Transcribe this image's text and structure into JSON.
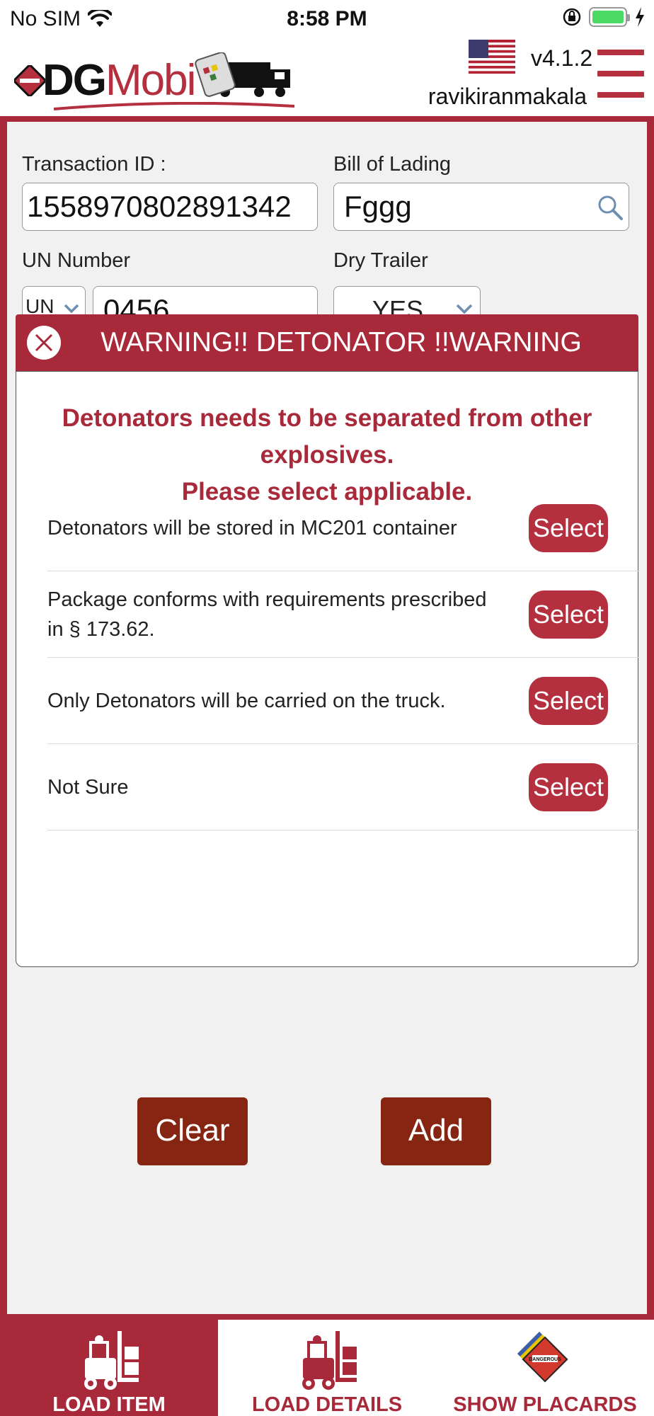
{
  "status_bar": {
    "carrier": "No SIM",
    "time": "8:58 PM"
  },
  "header": {
    "logo_dg": "DG",
    "logo_mobi": "Mobi",
    "version": "v4.1.2",
    "username": "ravikiranmakala"
  },
  "form": {
    "transaction_label": "Transaction ID :",
    "transaction_value": "1558970802891342",
    "bol_label": "Bill of Lading",
    "bol_value": "Fggg",
    "un_label": "UN Number",
    "un_prefix": "UN",
    "un_value": "0456",
    "dry_trailer_label": "Dry Trailer",
    "dry_trailer_value": "YES",
    "clear_label": "Clear",
    "add_label": "Add"
  },
  "modal": {
    "title": "WARNING!! DETONATOR !!WARNING",
    "message_line1": "Detonators needs to be separated from other explosives.",
    "message_line2": "Please select applicable.",
    "options": [
      {
        "text": "Detonators will be stored in MC201 container",
        "button": "Select"
      },
      {
        "text": "Package conforms with requirements prescribed in § 173.62.",
        "button": "Select"
      },
      {
        "text": "Only Detonators will be carried on the truck.",
        "button": "Select"
      },
      {
        "text": "Not Sure",
        "button": "Select"
      }
    ]
  },
  "tabs": [
    {
      "label": "LOAD ITEM",
      "active": true
    },
    {
      "label": "LOAD DETAILS",
      "active": false
    },
    {
      "label": "SHOW PLACARDS",
      "active": false
    }
  ],
  "colors": {
    "brand_red": "#a82a3a",
    "button_brown": "#862511",
    "panel_gray": "#f0f1f0"
  }
}
